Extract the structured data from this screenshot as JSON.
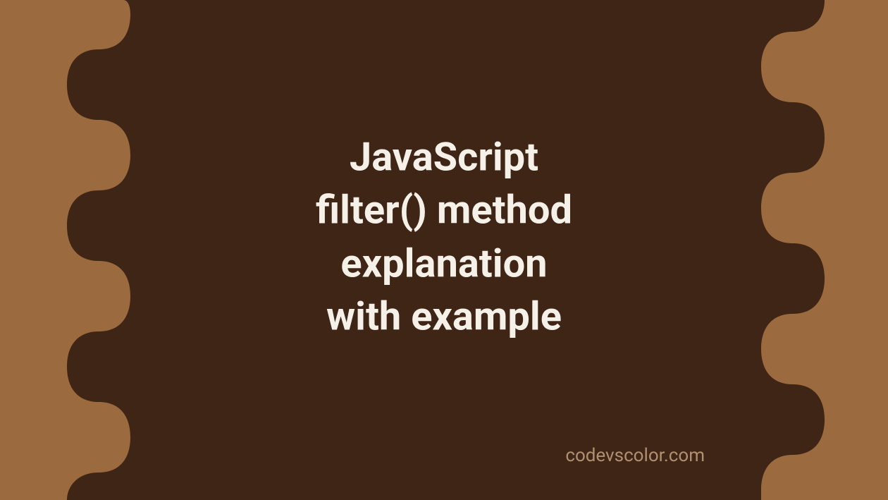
{
  "title": {
    "line1": "JavaScript",
    "line2": "filter() method",
    "line3": "explanation",
    "line4": "with example"
  },
  "watermark": "codevscolor.com",
  "colors": {
    "background": "#9b6b3f",
    "blob": "#3f2516",
    "text": "#f5f0e8",
    "watermark": "#b09070"
  }
}
